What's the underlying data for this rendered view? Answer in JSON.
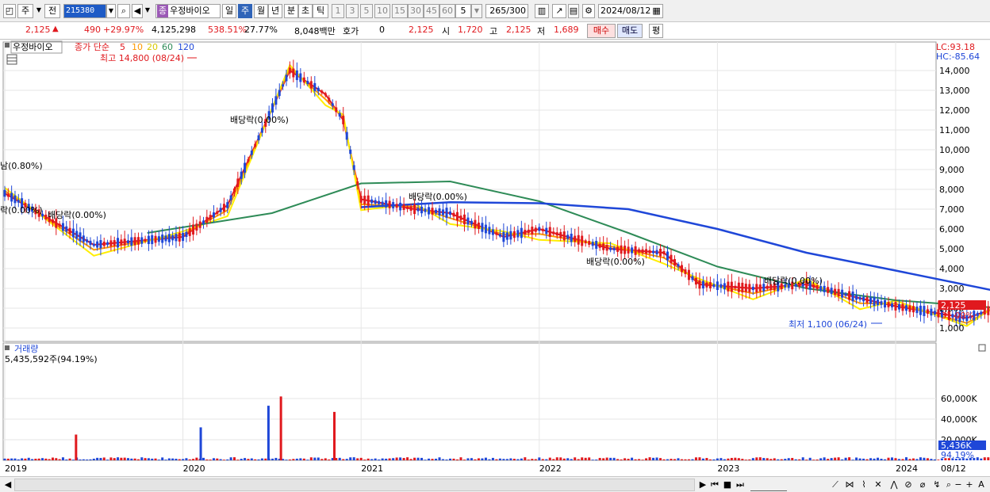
{
  "toolbar": {
    "market_type": "주",
    "mode": "전",
    "stock_code": "215380",
    "stock_name": "우정바이오",
    "name_badge": "종",
    "periods": [
      "일",
      "주",
      "월",
      "년",
      "분",
      "초",
      "틱"
    ],
    "selected_period": "주",
    "intervals": [
      "1",
      "3",
      "5",
      "10",
      "15",
      "30",
      "45",
      "60"
    ],
    "interval_value": "5",
    "count_value": "265",
    "count_max": "/300",
    "date": "2024/08/12"
  },
  "quote": {
    "price": "2,125",
    "change": "490",
    "change_pct": "+29.97%",
    "volume": "4,125,298",
    "volume_pct": "538.51%",
    "turnover": "27.77%",
    "amount": "8,048백만",
    "hoga_label": "호가",
    "hoga_value": "0",
    "hoga_price": "2,125",
    "open_label": "시",
    "open": "1,720",
    "high_label": "고",
    "high": "2,125",
    "low_label": "저",
    "low": "1,689",
    "buy_label": "매수",
    "sell_label": "매도",
    "avg_label": "평"
  },
  "price_panel": {
    "stock_label": "우정바이오",
    "ma_label": "종가 단순",
    "ma_periods": [
      "5",
      "10",
      "20",
      "60",
      "120"
    ],
    "ma_colors": [
      "#e0191e",
      "#ff9900",
      "#ffee00",
      "#2e8b57",
      "#1f47d8"
    ],
    "max_label": "최고 14,800 (08/24)",
    "min_label": "최저 1,100 (06/24)",
    "lc_label": "LC:93.18",
    "hc_label": "HC:-85.64",
    "current_price_tag": "2,125",
    "current_pct_tag": "31.09%",
    "y_ticks": [
      "14,000",
      "13,000",
      "12,000",
      "11,000",
      "10,000",
      "9,000",
      "8,000",
      "7,000",
      "6,000",
      "5,000",
      "4,000",
      "3,000",
      "2,000",
      "1,000"
    ],
    "dividend_label": "배당락(0.00%)",
    "left_label_a": "남(0.80%)",
    "left_label_b": "락(0.00%)"
  },
  "volume_panel": {
    "title": "거래량",
    "value_label": "5,435,592주(94.19%)",
    "y_ticks": [
      "60,000K",
      "40,000K",
      "20,000K"
    ],
    "current_tag": "5,436K",
    "current_pct_tag": "94.19%"
  },
  "x_axis": {
    "labels": [
      "2019",
      "2020",
      "2021",
      "2022",
      "2023",
      "2024"
    ],
    "end_label": "08/12"
  },
  "chart_data": {
    "type": "line",
    "title": "",
    "series": [
      {
        "name": "종가",
        "x": [
          "2019",
          "2019.5",
          "2020",
          "2020.25",
          "2020.6",
          "2020.8",
          "2020.9",
          "2021",
          "2021.3",
          "2021.5",
          "2021.8",
          "2022",
          "2022.4",
          "2022.7",
          "2022.9",
          "2023.2",
          "2023.5",
          "2023.8",
          "2024",
          "2024.4",
          "2024.6"
        ],
        "values": [
          7800,
          5200,
          5600,
          7200,
          14000,
          12800,
          11500,
          7500,
          7000,
          6800,
          5600,
          6000,
          5000,
          4800,
          3200,
          3000,
          3200,
          2500,
          2100,
          1500,
          2125
        ]
      },
      {
        "name": "120",
        "x": [
          "2021",
          "2021.5",
          "2022",
          "2022.5",
          "2023",
          "2023.5",
          "2024",
          "2024.6"
        ],
        "values": [
          7100,
          7350,
          7300,
          7000,
          6000,
          4800,
          3900,
          2800
        ]
      },
      {
        "name": "60",
        "x": [
          "2019.8",
          "2020.5",
          "2021",
          "2021.5",
          "2022",
          "2022.5",
          "2023",
          "2023.5",
          "2024",
          "2024.6"
        ],
        "values": [
          5800,
          6800,
          8300,
          8400,
          7400,
          5800,
          4100,
          3000,
          2400,
          2000
        ]
      }
    ],
    "volume_series": {
      "name": "거래량",
      "unit": "K",
      "peaks": [
        {
          "x": "2020.55",
          "value": 62000
        },
        {
          "x": "2020.48",
          "value": 53000
        },
        {
          "x": "2020.85",
          "value": 47000
        },
        {
          "x": "2020.1",
          "value": 32000
        },
        {
          "x": "2019.4",
          "value": 25000
        },
        {
          "x": "2024.6",
          "value": 5436
        }
      ]
    },
    "ylim": [
      700,
      15000
    ],
    "xlabel": "",
    "ylabel": ""
  }
}
